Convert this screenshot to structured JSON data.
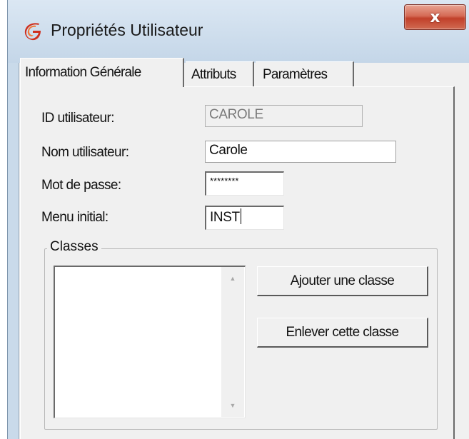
{
  "window": {
    "title": "Propriétés Utilisateur",
    "close_glyph": "x",
    "icon": "app-logo-icon",
    "accent": "#c1402a"
  },
  "tabs": [
    {
      "label": "Information Générale",
      "active": true
    },
    {
      "label": "Attributs",
      "active": false
    },
    {
      "label": "Paramètres",
      "active": false
    }
  ],
  "form": {
    "user_id_label": "ID utilisateur:",
    "user_id_value": "CAROLE",
    "user_name_label": "Nom utilisateur:",
    "user_name_value": "Carole",
    "password_label": "Mot de passe:",
    "password_value": "********",
    "initial_menu_label": "Menu initial:",
    "initial_menu_value": "INST"
  },
  "classes": {
    "group_title": "Classes",
    "items": [],
    "add_button": "Ajouter une classe",
    "remove_button": "Enlever cette classe"
  }
}
